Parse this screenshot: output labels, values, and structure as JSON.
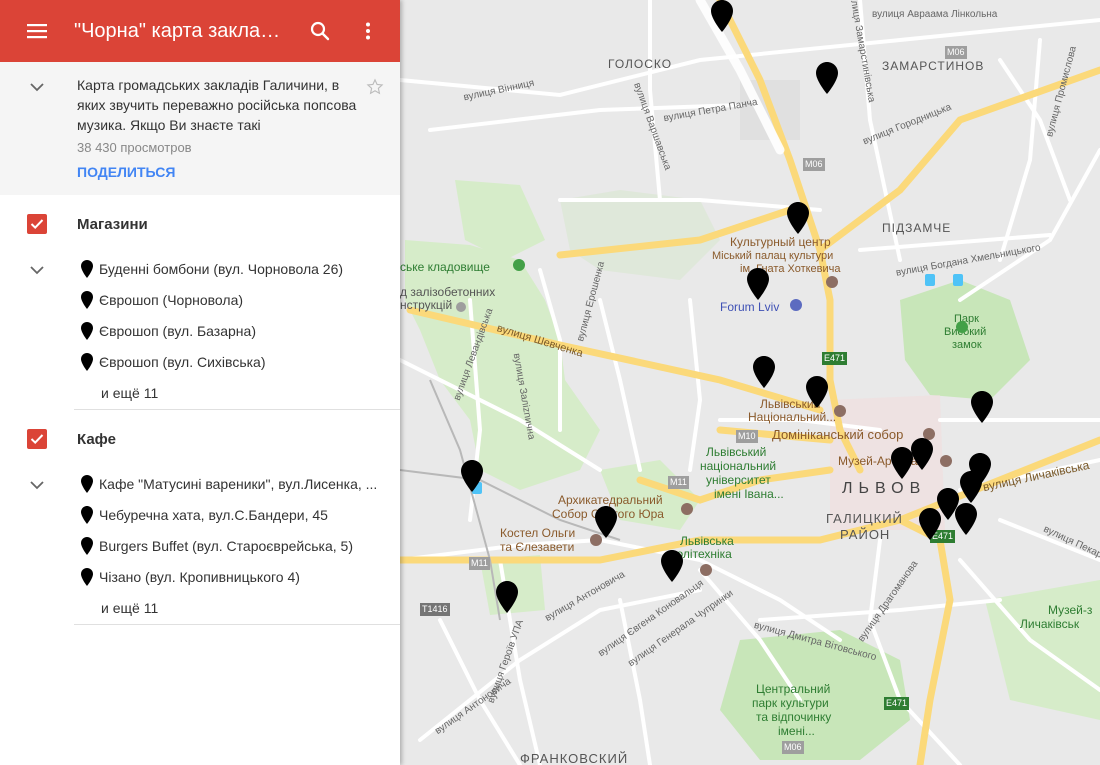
{
  "header": {
    "title": "\"Чорна\" карта закладі...",
    "menu_icon": "hamburger-menu-icon",
    "search_icon": "search-icon",
    "more_icon": "more-vert-icon"
  },
  "description": {
    "text": "Карта громадських закладів Галичини, в яких звучить переважно російська попсова музика. Якщо Ви знаєте такі",
    "views": "38 430 просмотров",
    "share_label": "ПОДЕЛИТЬСЯ"
  },
  "layers": [
    {
      "title": "Магазини",
      "checked": true,
      "items": [
        {
          "label": "Буденні бомбони (вул. Чорновола 26)"
        },
        {
          "label": "Єврошоп (Чорновола)"
        },
        {
          "label": "Єврошоп (вул. Базарна)"
        },
        {
          "label": "Єврошоп (вул. Сихівська)"
        }
      ],
      "more": "и ещё 11"
    },
    {
      "title": "Кафе",
      "checked": true,
      "items": [
        {
          "label": "Кафе \"Матусині вареники\", вул.Лисенка, ..."
        },
        {
          "label": "Чебуречна хата, вул.С.Бандери, 45"
        },
        {
          "label": "Burgers Buffet (вул. Староєврейська, 5)"
        },
        {
          "label": "Чізано (вул. Кропивницького 4)"
        }
      ],
      "more": "и ещё 11"
    }
  ],
  "map": {
    "colors": {
      "accent": "#db4437",
      "link": "#4285f4",
      "park": "#c8e6c9",
      "road_major": "#fde293",
      "road": "#ffffff",
      "background": "#e9e9e9"
    },
    "labels": [
      {
        "text": "ГОЛОСКО"
      },
      {
        "text": "ЗАМАРСТИНОВ"
      },
      {
        "text": "вулиця Авраама Лінкольна"
      },
      {
        "text": "вулиця Вінниця"
      },
      {
        "text": "вулиця Петра Панча"
      },
      {
        "text": "вулиця Варшавська"
      },
      {
        "text": "вулиця Городницька"
      },
      {
        "text": "вулиця Промислова"
      },
      {
        "text": "вулиця Богдана Хмельницького"
      },
      {
        "text": "M06"
      },
      {
        "text": "M06"
      },
      {
        "text": "ПІДЗАМЧЕ"
      },
      {
        "text": "Культурный центр"
      },
      {
        "text": "Міський палац культури"
      },
      {
        "text": "ім. Гната Хоткевича"
      },
      {
        "text": "ське кладовище"
      },
      {
        "text": "д залізобетонних"
      },
      {
        "text": "нструкцій"
      },
      {
        "text": "Forum Lviv"
      },
      {
        "text": "вулиця Шевченка"
      },
      {
        "text": "вулиця Левандівська"
      },
      {
        "text": "вулиця Заліznична"
      },
      {
        "text": "вулиця Ерошенка"
      },
      {
        "text": "вулиця Замарстинівська"
      },
      {
        "text": "E471"
      },
      {
        "text": "Парк"
      },
      {
        "text": "Високий"
      },
      {
        "text": "замок"
      },
      {
        "text": "Львівський"
      },
      {
        "text": "Національний..."
      },
      {
        "text": "M10"
      },
      {
        "text": "Домініканський собор"
      },
      {
        "text": "Музей-Арсенал"
      },
      {
        "text": "Львівський"
      },
      {
        "text": "національний"
      },
      {
        "text": "університет"
      },
      {
        "text": "імені Івана..."
      },
      {
        "text": "М11"
      },
      {
        "text": "ЛЬВОВ"
      },
      {
        "text": "вулиця Личаківська"
      },
      {
        "text": "ГАЛИЦКИЙ"
      },
      {
        "text": "РАЙОН"
      },
      {
        "text": "Архикатедральний"
      },
      {
        "text": "Собор Святого Юра"
      },
      {
        "text": "Костел Ольги"
      },
      {
        "text": "та Єлезавети"
      },
      {
        "text": "Львівська"
      },
      {
        "text": "політехніка"
      },
      {
        "text": "M11"
      },
      {
        "text": "T1416"
      },
      {
        "text": "E471"
      },
      {
        "text": "вулиця Пекарська"
      },
      {
        "text": "вулиця Антоновича"
      },
      {
        "text": "вулиця Євгена Коновальця"
      },
      {
        "text": "вулиця Генерала Чупринки"
      },
      {
        "text": "вулиця Героїв УПА"
      },
      {
        "text": "вулиця Дмитра Вітовського"
      },
      {
        "text": "вулиця Драгоманова"
      },
      {
        "text": "Музей-з"
      },
      {
        "text": "Личаківськ"
      },
      {
        "text": "Центральний"
      },
      {
        "text": "парк культури"
      },
      {
        "text": "та відпочинку"
      },
      {
        "text": "імені..."
      },
      {
        "text": "E471"
      },
      {
        "text": "M06"
      },
      {
        "text": "ФРАНКОВСКИЙ"
      },
      {
        "text": "вулиця Антоновича"
      }
    ]
  }
}
